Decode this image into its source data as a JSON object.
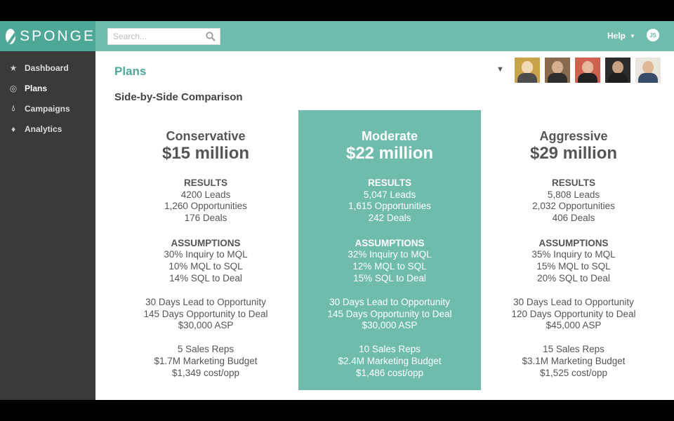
{
  "brand": {
    "name": "SPONGE"
  },
  "search": {
    "placeholder": "Search..."
  },
  "header": {
    "help_label": "Help",
    "user_initials": "JS"
  },
  "sidebar": {
    "items": [
      {
        "label": "Dashboard",
        "icon": "star-icon"
      },
      {
        "label": "Plans",
        "icon": "target-icon"
      },
      {
        "label": "Campaigns",
        "icon": "drop-icon"
      },
      {
        "label": "Analytics",
        "icon": "diamond-icon"
      }
    ]
  },
  "main": {
    "title": "Plans",
    "subtitle": "Side-by-Side Comparison"
  },
  "team": [
    {
      "bg": "#c9a24a",
      "head": "#f1d9b8",
      "body": "#4d4d4d"
    },
    {
      "bg": "#8a6a4e",
      "head": "#d6b08e",
      "body": "#2e2e2e"
    },
    {
      "bg": "#d0614f",
      "head": "#e8b89c",
      "body": "#222222"
    },
    {
      "bg": "#2b2b2b",
      "head": "#c8a084",
      "body": "#1e1e1e"
    },
    {
      "bg": "#e9e6de",
      "head": "#e0b894",
      "body": "#394d6b"
    }
  ],
  "plans": [
    {
      "name": "Conservative",
      "amount": "$15 million",
      "results_label": "RESULTS",
      "results": [
        "4200 Leads",
        "1,260 Opportunities",
        "176 Deals"
      ],
      "assumptions_label": "ASSUMPTIONS",
      "assumptions": [
        "30% Inquiry to MQL",
        "10% MQL to SQL",
        "14% SQL to Deal"
      ],
      "timing": [
        "30 Days Lead to Opportunity",
        "145 Days Opportunity to Deal",
        "$30,000 ASP"
      ],
      "resources": [
        "5 Sales Reps",
        "$1.7M Marketing Budget",
        "$1,349 cost/opp"
      ]
    },
    {
      "name": "Moderate",
      "amount": "$22 million",
      "results_label": "RESULTS",
      "results": [
        "5,047 Leads",
        "1,615 Opportunities",
        "242 Deals"
      ],
      "assumptions_label": "ASSUMPTIONS",
      "assumptions": [
        "32% Inquiry to MQL",
        "12% MQL to SQL",
        "15% SQL to Deal"
      ],
      "timing": [
        "30 Days Lead to Opportunity",
        "145 Days Opportunity to Deal",
        "$30,000 ASP"
      ],
      "resources": [
        "10 Sales Reps",
        "$2.4M Marketing Budget",
        "$1,486 cost/opp"
      ]
    },
    {
      "name": "Aggressive",
      "amount": "$29 million",
      "results_label": "RESULTS",
      "results": [
        "5,808 Leads",
        "2,032 Opportunities",
        "406 Deals"
      ],
      "assumptions_label": "ASSUMPTIONS",
      "assumptions": [
        "35% Inquiry to MQL",
        "15% MQL to SQL",
        "20% SQL to Deal"
      ],
      "timing": [
        "30 Days Lead to Opportunity",
        "120 Days Opportunity to Deal",
        "$45,000 ASP"
      ],
      "resources": [
        "15 Sales Reps",
        "$3.1M Marketing Budget",
        "$1,525 cost/opp"
      ]
    }
  ],
  "colors": {
    "accent": "#6fbcad",
    "accent_dark": "#4ea898",
    "sidebar": "#3a3a3a"
  }
}
